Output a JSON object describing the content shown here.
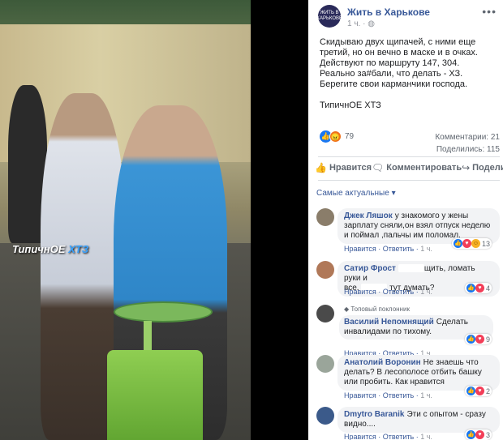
{
  "photo": {
    "watermark_a": "ТипичнОЕ",
    "watermark_b": "ХТЗ"
  },
  "post": {
    "page_name": "Жить в Харькове",
    "page_logo_text": "ЖИТЬ В ХАРЬКОВЕ",
    "time": "1 ч.",
    "globe_icon": "globe-icon",
    "more": "•••",
    "text_lines": [
      "Скидываю двух щипачей, с ними еще третий, но он вечно в маске и в очках. Действуют по маршруту 147, 304.",
      "Реально за#бали, что делать - ХЗ. Берегите свои карманчики господа.",
      "ТипичнОЕ ХТЗ"
    ],
    "reaction_count": "79",
    "comments_stat": "Комментарии: 21",
    "shares_stat": "Поделились: 115"
  },
  "actions": {
    "like": "Нравится",
    "comment": "Комментировать",
    "share": "Поделиться"
  },
  "sort_label": "Самые актуальные ▾",
  "comments": [
    {
      "name": "Джек Ляшок",
      "text": "у знакомого у жены зарплату сняли,он взял отпуск неделю и поймал ,пальчы им поломал.",
      "like": "Нравится",
      "reply": "Ответить",
      "time": "1 ч.",
      "reacts": "13"
    },
    {
      "name": "Сатир Фрост",
      "text_a": "щить, ломать руки и",
      "text_b": "все.",
      "text_c": "тут думать?",
      "like": "Нравится",
      "reply": "Ответить",
      "time": "1 ч.",
      "reacts": "4"
    },
    {
      "badge": "Топовый поклонник",
      "name": "Василий Непомнящий",
      "text": "Сделать инвалидами по тихому.",
      "like": "Нравится",
      "reply": "Ответить",
      "time": "1 ч.",
      "reacts": "9"
    },
    {
      "name": "Анатолий Воронин",
      "text": "Не знаешь что делать? В лесополосе отбить башку или пробить. Как нравится",
      "like": "Нравится",
      "reply": "Ответить",
      "time": "1 ч.",
      "reacts": "2"
    },
    {
      "name": "Dmytro Baranik",
      "text": "Эти с опытом - сразу видно....",
      "like": "Нравится",
      "reply": "Ответить",
      "time": "1 ч.",
      "reacts": "3"
    }
  ],
  "colors": {
    "link": "#385898",
    "like_blue": "#1877f2",
    "love_red": "#f33e58",
    "bin_green": "#7bb85c"
  }
}
